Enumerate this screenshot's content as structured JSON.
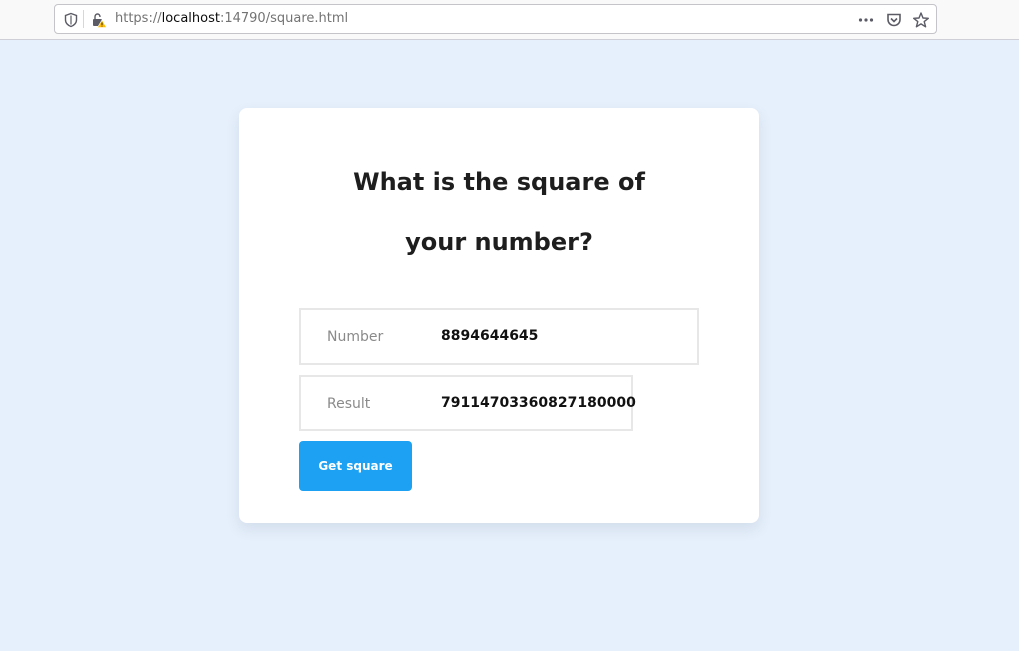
{
  "browser": {
    "url_scheme": "https://",
    "url_host": "localhost",
    "url_rest": ":14790/square.html",
    "icons": [
      "shield-icon",
      "lock-warning-icon",
      "more-dots-icon",
      "pocket-icon",
      "star-icon"
    ]
  },
  "card": {
    "title": "What is the square of your number?",
    "number_label": "Number",
    "number_value": "8894644645",
    "result_label": "Result",
    "result_value": "79114703360827180000",
    "button_label": "Get square"
  },
  "colors": {
    "page_bg": "#e6f0fc",
    "button_bg": "#1da1f2",
    "card_bg": "#ffffff"
  }
}
